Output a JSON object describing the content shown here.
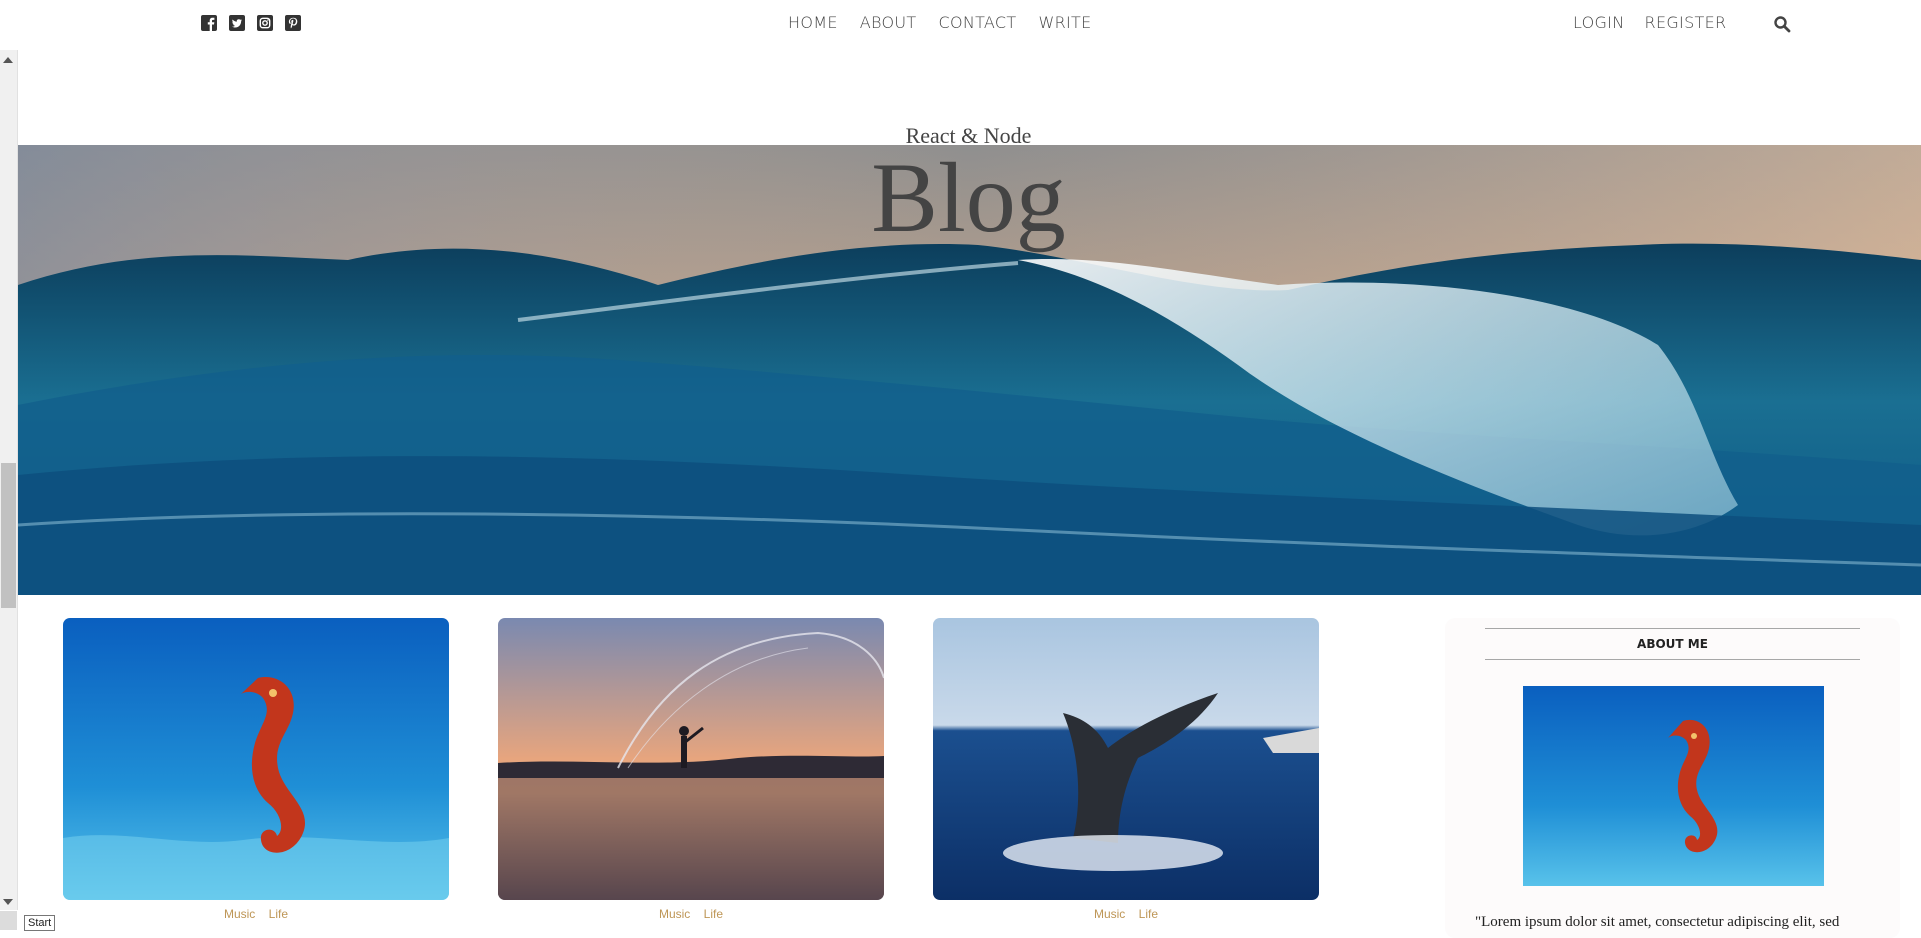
{
  "social": {
    "icons": [
      "facebook-square-icon",
      "twitter-square-icon",
      "instagram-square-icon",
      "pinterest-square-icon"
    ]
  },
  "nav": {
    "items": [
      "HOME",
      "ABOUT",
      "CONTACT",
      "WRITE"
    ]
  },
  "auth": {
    "login": "LOGIN",
    "register": "REGISTER",
    "search_icon": "search-icon"
  },
  "header": {
    "title_sm": "React & Node",
    "title_lg": "Blog"
  },
  "posts": [
    {
      "image": "seahorse-photo",
      "categories": [
        "Music",
        "Life"
      ]
    },
    {
      "image": "fisherman-sunset-photo",
      "categories": [
        "Music",
        "Life"
      ]
    },
    {
      "image": "whale-tail-photo",
      "categories": [
        "Music",
        "Life"
      ]
    }
  ],
  "sidebar": {
    "title": "ABOUT ME",
    "image": "seahorse-photo",
    "text": "\"Lorem ipsum dolor sit amet, consectetur adipiscing elit, sed"
  },
  "tooltip": {
    "start": "Start"
  },
  "colors": {
    "accent": "#be9656",
    "text": "#444444"
  }
}
